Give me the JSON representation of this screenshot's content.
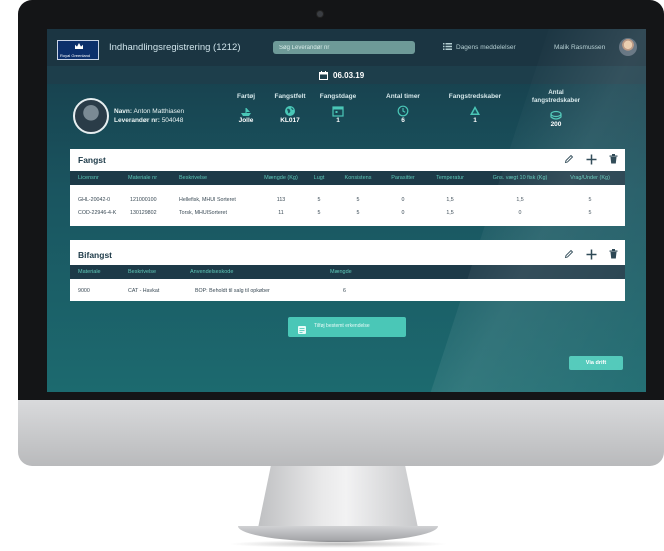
{
  "header": {
    "logo_text": "Royal Greenland",
    "title": "Indhandlingsregistrering (1212)",
    "search_placeholder": "Søg Leverandør nr",
    "messages_label": "Dagens meddelelser",
    "user_name": "Malik Rasmussen"
  },
  "date": "06.03.19",
  "fisher": {
    "name_label": "Navn:",
    "name": "Anton Matthiasen",
    "supplier_label": "Leverandør nr:",
    "supplier_no": "504048"
  },
  "stats": [
    {
      "label": "Fartøj",
      "value": "Jolle",
      "icon": "boat-icon"
    },
    {
      "label": "Fangstfelt",
      "value": "KL017",
      "icon": "globe-icon"
    },
    {
      "label": "Fangstdage",
      "value": "1",
      "icon": "calendar-icon"
    },
    {
      "label": "Antal timer",
      "value": "6",
      "icon": "clock-icon"
    },
    {
      "label": "Fangstredskaber",
      "value": "1",
      "icon": "gear-icon"
    },
    {
      "label": "Antal fangstredskaber",
      "value": "200",
      "icon": "net-icon"
    }
  ],
  "catch": {
    "title": "Fangst",
    "columns": [
      "Licensnr",
      "Materiale nr",
      "Beskrivelse",
      "Mængde (Kg)",
      "Lugt",
      "Konsistens",
      "Parasitter",
      "Temperatur",
      "Gns. vægt 10 fisk (Kg)",
      "Vrag/Under (Kg)"
    ],
    "rows": [
      [
        "GHL-20042-0",
        "121000100",
        "Hellefisk, MHUI Sorteret",
        "113",
        "5",
        "5",
        "0",
        "1,5",
        "1,5",
        "5"
      ],
      [
        "COD-22946-4-K",
        "130129802",
        "Torsk, MHUISorteret",
        "11",
        "5",
        "5",
        "0",
        "1,5",
        "0",
        "5"
      ]
    ]
  },
  "bycatch": {
    "title": "Bifangst",
    "columns": [
      "Materiale",
      "Beskrivelse",
      "Anvendelseskode",
      "Mængde"
    ],
    "rows": [
      [
        "9000",
        "CAT - Havkat",
        "BOP: Beholdt til salg til opkøber",
        "6"
      ]
    ]
  },
  "buttons": {
    "add_receipt": "Tilføj bestemt erkendelse",
    "send": "Via drift"
  },
  "colors": {
    "accent": "#4ac7b7",
    "header_dark": "#1d3a48",
    "background": "#1a5560"
  }
}
